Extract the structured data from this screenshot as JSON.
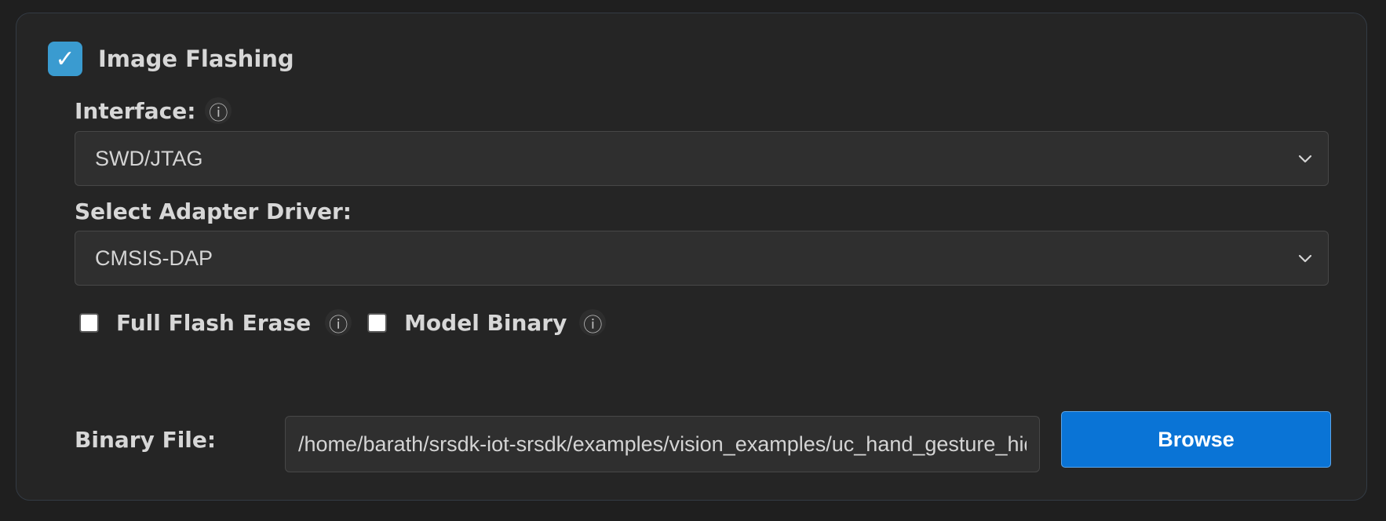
{
  "section": {
    "title": "Image Flashing",
    "enabled": true,
    "check_glyph": "✓"
  },
  "interface": {
    "label": "Interface:",
    "info_glyph": "ⓘ",
    "selected": "SWD/JTAG"
  },
  "adapter": {
    "label": "Select Adapter Driver:",
    "selected": "CMSIS-DAP"
  },
  "options": {
    "full_flash_erase": {
      "label": "Full Flash Erase",
      "checked": false,
      "info_glyph": "ⓘ"
    },
    "model_binary": {
      "label": "Model Binary",
      "checked": false,
      "info_glyph": "ⓘ"
    }
  },
  "binary_file": {
    "label": "Binary File:",
    "value": "/home/barath/srsdk-iot-srsdk/examples/vision_examples/uc_hand_gesture_hid"
  },
  "browse_button": {
    "label": "Browse"
  },
  "colors": {
    "accent_checkbox": "#3a9bd0",
    "browse_button": "#0a74d6",
    "panel_bg": "#252525",
    "page_bg": "#1f1f1f"
  }
}
